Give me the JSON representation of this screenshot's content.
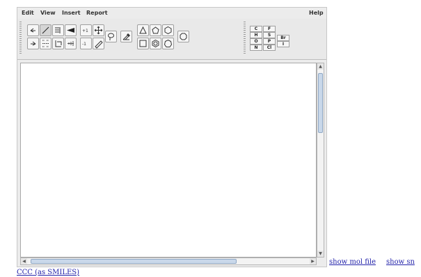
{
  "menubar": {
    "edit": "Edit",
    "view": "View",
    "insert": "Insert",
    "report": "Report",
    "help": "Help"
  },
  "toolbar": {
    "charge_plus": "+1",
    "charge_minus": "-1",
    "elements": [
      "C",
      "F",
      "H",
      "S",
      "Br",
      "O",
      "P",
      "I",
      "N",
      "Cl"
    ]
  },
  "links": {
    "mol_file": "show mol file",
    "smiles_trunc": "show sn",
    "smiles_value": "CCC (as SMILES)"
  }
}
